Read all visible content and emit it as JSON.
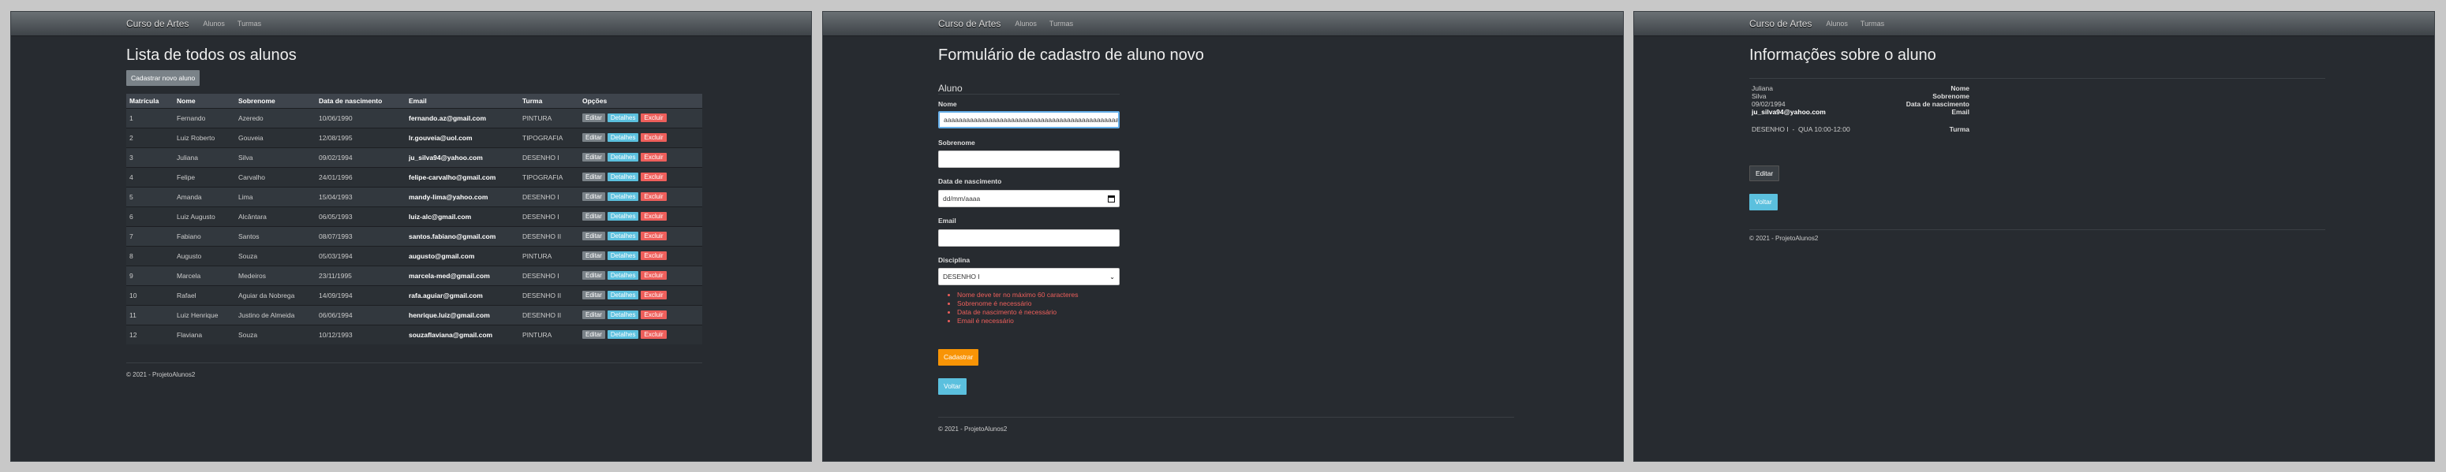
{
  "nav": {
    "brand": "Curso de Artes",
    "link_alunos": "Alunos",
    "link_turmas": "Turmas"
  },
  "list_page": {
    "title": "Lista de todos os alunos",
    "add_button": "Cadastrar novo aluno",
    "headers": [
      "Matrícula",
      "Nome",
      "Sobrenome",
      "Data de nascimento",
      "Email",
      "Turma",
      "Opções"
    ],
    "rows": [
      [
        "1",
        "Fernando",
        "Azeredo",
        "10/06/1990",
        "fernando.az@gmail.com",
        "PINTURA"
      ],
      [
        "2",
        "Luiz Roberto",
        "Gouveia",
        "12/08/1995",
        "lr.gouveia@uol.com",
        "TIPOGRAFIA"
      ],
      [
        "3",
        "Juliana",
        "Silva",
        "09/02/1994",
        "ju_silva94@yahoo.com",
        "DESENHO I"
      ],
      [
        "4",
        "Felipe",
        "Carvalho",
        "24/01/1996",
        "felipe-carvalho@gmail.com",
        "TIPOGRAFIA"
      ],
      [
        "5",
        "Amanda",
        "Lima",
        "15/04/1993",
        "mandy-lima@yahoo.com",
        "DESENHO I"
      ],
      [
        "6",
        "Luiz Augusto",
        "Alcântara",
        "06/05/1993",
        "luiz-alc@gmail.com",
        "DESENHO I"
      ],
      [
        "7",
        "Fabiano",
        "Santos",
        "08/07/1993",
        "santos.fabiano@gmail.com",
        "DESENHO II"
      ],
      [
        "8",
        "Augusto",
        "Souza",
        "05/03/1994",
        "augusto@gmail.com",
        "PINTURA"
      ],
      [
        "9",
        "Marcela",
        "Medeiros",
        "23/11/1995",
        "marcela-med@gmail.com",
        "DESENHO I"
      ],
      [
        "10",
        "Rafael",
        "Aguiar da Nobrega",
        "14/09/1994",
        "rafa.aguiar@gmail.com",
        "DESENHO II"
      ],
      [
        "11",
        "Luiz Henrique",
        "Justino de Almeida",
        "06/06/1994",
        "henrique.luiz@gmail.com",
        "DESENHO II"
      ],
      [
        "12",
        "Flaviana",
        "Souza",
        "10/12/1993",
        "souzaflaviana@gmail.com",
        "PINTURA"
      ]
    ],
    "btn_edit": "Editar",
    "btn_details": "Detalhes",
    "btn_delete": "Excluir",
    "footer": "© 2021 - ProjetoAlunos2"
  },
  "form_page": {
    "title": "Formulário de cadastro de aluno novo",
    "section": "Aluno",
    "label_nome": "Nome",
    "nome_value": "aaaaaaaaaaaaaaaaaaaaaaaaaaaaaaaaaaaaaaaaaaaaaaaaaaaaaaaaaaaaaaaaaa",
    "label_sobrenome": "Sobrenome",
    "label_data": "Data de nascimento",
    "data_placeholder": "dd/mm/aaaa",
    "label_email": "Email",
    "label_disciplina": "Disciplina",
    "disciplina_value": "DESENHO I",
    "errors": [
      "Nome deve ter no máximo 60 caracteres",
      "Sobrenome é necessário",
      "Data de nascimento é necessário",
      "Email é necessário"
    ],
    "submit": "Cadastrar",
    "back": "Voltar",
    "footer": "© 2021 - ProjetoAlunos2"
  },
  "detail_page": {
    "title": "Informações sobre o aluno",
    "k_nome": "Nome",
    "v_nome": "Juliana",
    "k_sobrenome": "Sobrenome",
    "v_sobrenome": "Silva",
    "k_data": "Data de nascimento",
    "v_data": "09/02/1994",
    "k_email": "Email",
    "v_email": "ju_silva94@yahoo.com",
    "k_turma": "Turma",
    "v_turma": "DESENHO I  -  QUA 10:00-12:00",
    "edit": "Editar",
    "back": "Voltar",
    "footer": "© 2021 - ProjetoAlunos2"
  },
  "colors": {
    "page_bg": "#272b30",
    "info": "#5bc0de",
    "danger": "#ee5f5b",
    "warning": "#f89406"
  }
}
